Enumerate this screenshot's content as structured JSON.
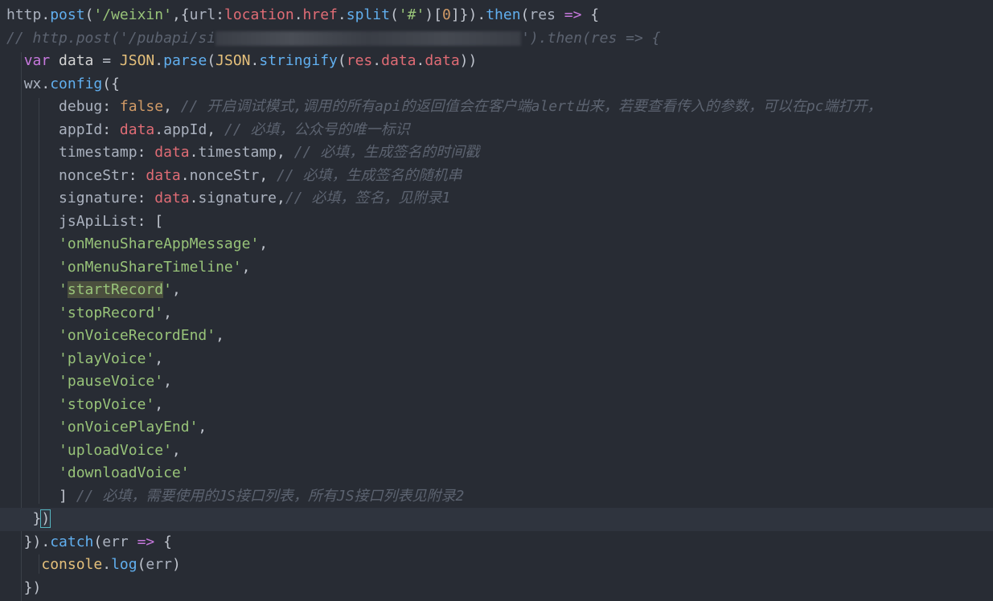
{
  "editor": {
    "lines": [
      [
        {
          "c": "ident",
          "t": "http"
        },
        {
          "c": "punc",
          "t": "."
        },
        {
          "c": "fn",
          "t": "post"
        },
        {
          "c": "punc",
          "t": "("
        },
        {
          "c": "str",
          "t": "'/weixin'"
        },
        {
          "c": "punc",
          "t": ",{"
        },
        {
          "c": "ident",
          "t": "url"
        },
        {
          "c": "punc",
          "t": ":"
        },
        {
          "c": "prop",
          "t": "location"
        },
        {
          "c": "punc",
          "t": "."
        },
        {
          "c": "prop",
          "t": "href"
        },
        {
          "c": "punc",
          "t": "."
        },
        {
          "c": "fn",
          "t": "split"
        },
        {
          "c": "punc",
          "t": "("
        },
        {
          "c": "str",
          "t": "'#'"
        },
        {
          "c": "punc",
          "t": ")["
        },
        {
          "c": "bool",
          "t": "0"
        },
        {
          "c": "punc",
          "t": "]})."
        },
        {
          "c": "fn",
          "t": "then"
        },
        {
          "c": "punc",
          "t": "("
        },
        {
          "c": "ident",
          "t": "res"
        },
        {
          "c": "punc",
          "t": " "
        },
        {
          "c": "op",
          "t": "=>"
        },
        {
          "c": "punc",
          "t": " {"
        }
      ],
      [
        {
          "c": "cmt",
          "t": "// http.post('/pubapi/si"
        },
        {
          "c": "blur",
          "t": ""
        },
        {
          "c": "cmt",
          "t": "').then(res => {"
        }
      ],
      [
        {
          "c": "punc",
          "t": "  "
        },
        {
          "c": "key",
          "t": "var"
        },
        {
          "c": "punc",
          "t": " "
        },
        {
          "c": "var",
          "t": "data"
        },
        {
          "c": "punc",
          "t": " = "
        },
        {
          "c": "obj",
          "t": "JSON"
        },
        {
          "c": "punc",
          "t": "."
        },
        {
          "c": "fn",
          "t": "parse"
        },
        {
          "c": "punc",
          "t": "("
        },
        {
          "c": "obj",
          "t": "JSON"
        },
        {
          "c": "punc",
          "t": "."
        },
        {
          "c": "fn",
          "t": "stringify"
        },
        {
          "c": "punc",
          "t": "("
        },
        {
          "c": "prop",
          "t": "res"
        },
        {
          "c": "punc",
          "t": "."
        },
        {
          "c": "prop",
          "t": "data"
        },
        {
          "c": "punc",
          "t": "."
        },
        {
          "c": "prop",
          "t": "data"
        },
        {
          "c": "punc",
          "t": "))"
        }
      ],
      [
        {
          "c": "punc",
          "t": "  "
        },
        {
          "c": "ident",
          "t": "wx"
        },
        {
          "c": "punc",
          "t": "."
        },
        {
          "c": "fn",
          "t": "config"
        },
        {
          "c": "punc",
          "t": "({"
        }
      ],
      [
        {
          "c": "punc",
          "t": "      "
        },
        {
          "c": "ident",
          "t": "debug"
        },
        {
          "c": "punc",
          "t": ": "
        },
        {
          "c": "bool",
          "t": "false"
        },
        {
          "c": "punc",
          "t": ", "
        },
        {
          "c": "cmt",
          "t": "// 开启调试模式,调用的所有api的返回值会在客户端alert出来，若要查看传入的参数，可以在pc端打开，"
        }
      ],
      [
        {
          "c": "punc",
          "t": "      "
        },
        {
          "c": "ident",
          "t": "appId"
        },
        {
          "c": "punc",
          "t": ": "
        },
        {
          "c": "prop",
          "t": "data"
        },
        {
          "c": "punc",
          "t": "."
        },
        {
          "c": "ident",
          "t": "appId"
        },
        {
          "c": "punc",
          "t": ", "
        },
        {
          "c": "cmt",
          "t": "// 必填，公众号的唯一标识"
        }
      ],
      [
        {
          "c": "punc",
          "t": "      "
        },
        {
          "c": "ident",
          "t": "timestamp"
        },
        {
          "c": "punc",
          "t": ": "
        },
        {
          "c": "prop",
          "t": "data"
        },
        {
          "c": "punc",
          "t": "."
        },
        {
          "c": "ident",
          "t": "timestamp"
        },
        {
          "c": "punc",
          "t": ", "
        },
        {
          "c": "cmt",
          "t": "// 必填，生成签名的时间戳"
        }
      ],
      [
        {
          "c": "punc",
          "t": "      "
        },
        {
          "c": "ident",
          "t": "nonceStr"
        },
        {
          "c": "punc",
          "t": ": "
        },
        {
          "c": "prop",
          "t": "data"
        },
        {
          "c": "punc",
          "t": "."
        },
        {
          "c": "ident",
          "t": "nonceStr"
        },
        {
          "c": "punc",
          "t": ", "
        },
        {
          "c": "cmt",
          "t": "// 必填，生成签名的随机串"
        }
      ],
      [
        {
          "c": "punc",
          "t": "      "
        },
        {
          "c": "ident",
          "t": "signature"
        },
        {
          "c": "punc",
          "t": ": "
        },
        {
          "c": "prop",
          "t": "data"
        },
        {
          "c": "punc",
          "t": "."
        },
        {
          "c": "ident",
          "t": "signature"
        },
        {
          "c": "punc",
          "t": ","
        },
        {
          "c": "cmt",
          "t": "// 必填，签名，见附录1"
        }
      ],
      [
        {
          "c": "punc",
          "t": "      "
        },
        {
          "c": "ident",
          "t": "jsApiList"
        },
        {
          "c": "punc",
          "t": ": ["
        }
      ],
      [
        {
          "c": "punc",
          "t": "      "
        },
        {
          "c": "str",
          "t": "'onMenuShareAppMessage'"
        },
        {
          "c": "punc",
          "t": ","
        }
      ],
      [
        {
          "c": "punc",
          "t": "      "
        },
        {
          "c": "str",
          "t": "'onMenuShareTimeline'"
        },
        {
          "c": "punc",
          "t": ","
        }
      ],
      [
        {
          "c": "punc",
          "t": "      "
        },
        {
          "c": "str",
          "t": "'"
        },
        {
          "c": "str sel",
          "t": "startRecord"
        },
        {
          "c": "str",
          "t": "'"
        },
        {
          "c": "punc",
          "t": ","
        }
      ],
      [
        {
          "c": "punc",
          "t": "      "
        },
        {
          "c": "str",
          "t": "'stopRecord'"
        },
        {
          "c": "punc",
          "t": ","
        }
      ],
      [
        {
          "c": "punc",
          "t": "      "
        },
        {
          "c": "str",
          "t": "'onVoiceRecordEnd'"
        },
        {
          "c": "punc",
          "t": ","
        }
      ],
      [
        {
          "c": "punc",
          "t": "      "
        },
        {
          "c": "str",
          "t": "'playVoice'"
        },
        {
          "c": "punc",
          "t": ","
        }
      ],
      [
        {
          "c": "punc",
          "t": "      "
        },
        {
          "c": "str",
          "t": "'pauseVoice'"
        },
        {
          "c": "punc",
          "t": ","
        }
      ],
      [
        {
          "c": "punc",
          "t": "      "
        },
        {
          "c": "str",
          "t": "'stopVoice'"
        },
        {
          "c": "punc",
          "t": ","
        }
      ],
      [
        {
          "c": "punc",
          "t": "      "
        },
        {
          "c": "str",
          "t": "'onVoicePlayEnd'"
        },
        {
          "c": "punc",
          "t": ","
        }
      ],
      [
        {
          "c": "punc",
          "t": "      "
        },
        {
          "c": "str",
          "t": "'uploadVoice'"
        },
        {
          "c": "punc",
          "t": ","
        }
      ],
      [
        {
          "c": "punc",
          "t": "      "
        },
        {
          "c": "str",
          "t": "'downloadVoice'"
        }
      ],
      [
        {
          "c": "punc",
          "t": "      ] "
        },
        {
          "c": "cmt",
          "t": "// 必填，需要使用的JS接口列表，所有JS接口列表见附录2"
        }
      ],
      [
        {
          "c": "punc",
          "t": "   }"
        },
        {
          "c": "punc bracket-hl",
          "t": ")"
        }
      ],
      [
        {
          "c": "punc",
          "t": "  })."
        },
        {
          "c": "fn",
          "t": "catch"
        },
        {
          "c": "punc",
          "t": "("
        },
        {
          "c": "ident",
          "t": "err"
        },
        {
          "c": "punc",
          "t": " "
        },
        {
          "c": "op",
          "t": "=>"
        },
        {
          "c": "punc",
          "t": " {"
        }
      ],
      [
        {
          "c": "punc",
          "t": "    "
        },
        {
          "c": "obj",
          "t": "console"
        },
        {
          "c": "punc",
          "t": "."
        },
        {
          "c": "fn",
          "t": "log"
        },
        {
          "c": "punc",
          "t": "("
        },
        {
          "c": "ident",
          "t": "err"
        },
        {
          "c": "punc",
          "t": ")"
        }
      ],
      [
        {
          "c": "punc",
          "t": "  })"
        }
      ]
    ],
    "current_line": 22
  }
}
